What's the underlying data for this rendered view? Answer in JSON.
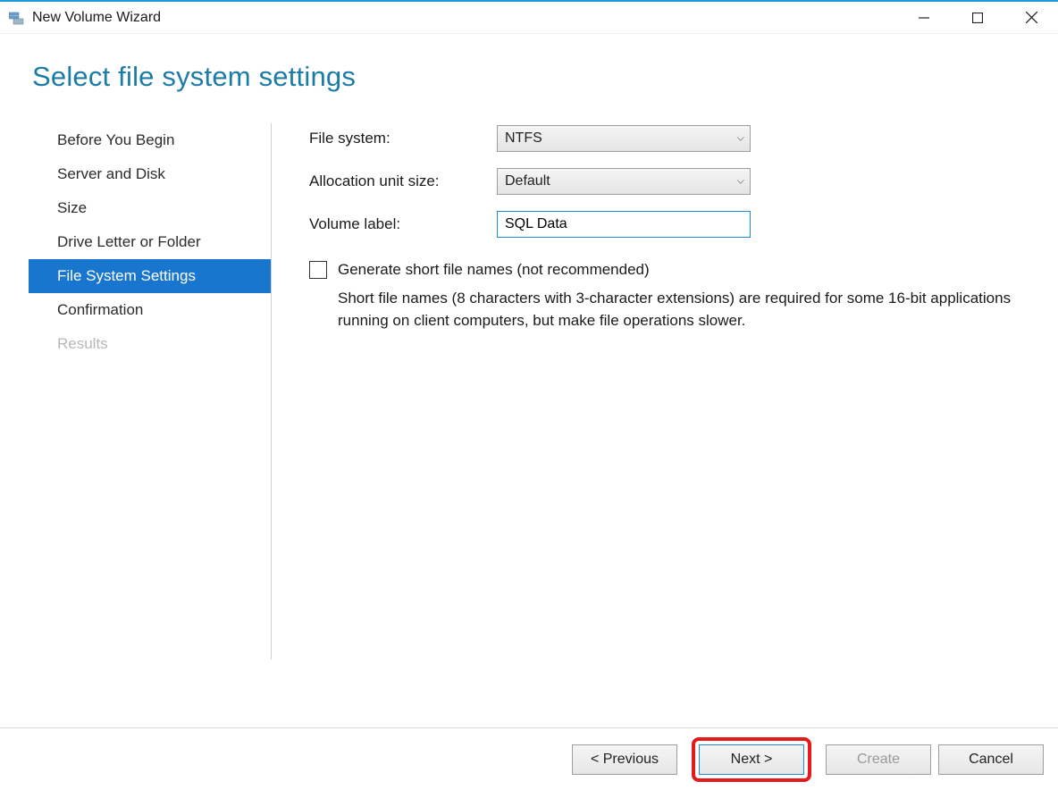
{
  "window": {
    "title": "New Volume Wizard"
  },
  "heading": "Select file system settings",
  "nav": {
    "items": [
      {
        "label": "Before You Begin"
      },
      {
        "label": "Server and Disk"
      },
      {
        "label": "Size"
      },
      {
        "label": "Drive Letter or Folder"
      },
      {
        "label": "File System Settings"
      },
      {
        "label": "Confirmation"
      },
      {
        "label": "Results"
      }
    ]
  },
  "form": {
    "file_system_label": "File system:",
    "file_system_value": "NTFS",
    "allocation_label": "Allocation unit size:",
    "allocation_value": "Default",
    "volume_label_label": "Volume label:",
    "volume_label_value": "SQL Data",
    "short_names_label": "Generate short file names (not recommended)",
    "short_names_help": "Short file names (8 characters with 3-character extensions) are required for some 16-bit applications running on client computers, but make file operations slower."
  },
  "footer": {
    "previous": "< Previous",
    "next": "Next >",
    "create": "Create",
    "cancel": "Cancel"
  }
}
